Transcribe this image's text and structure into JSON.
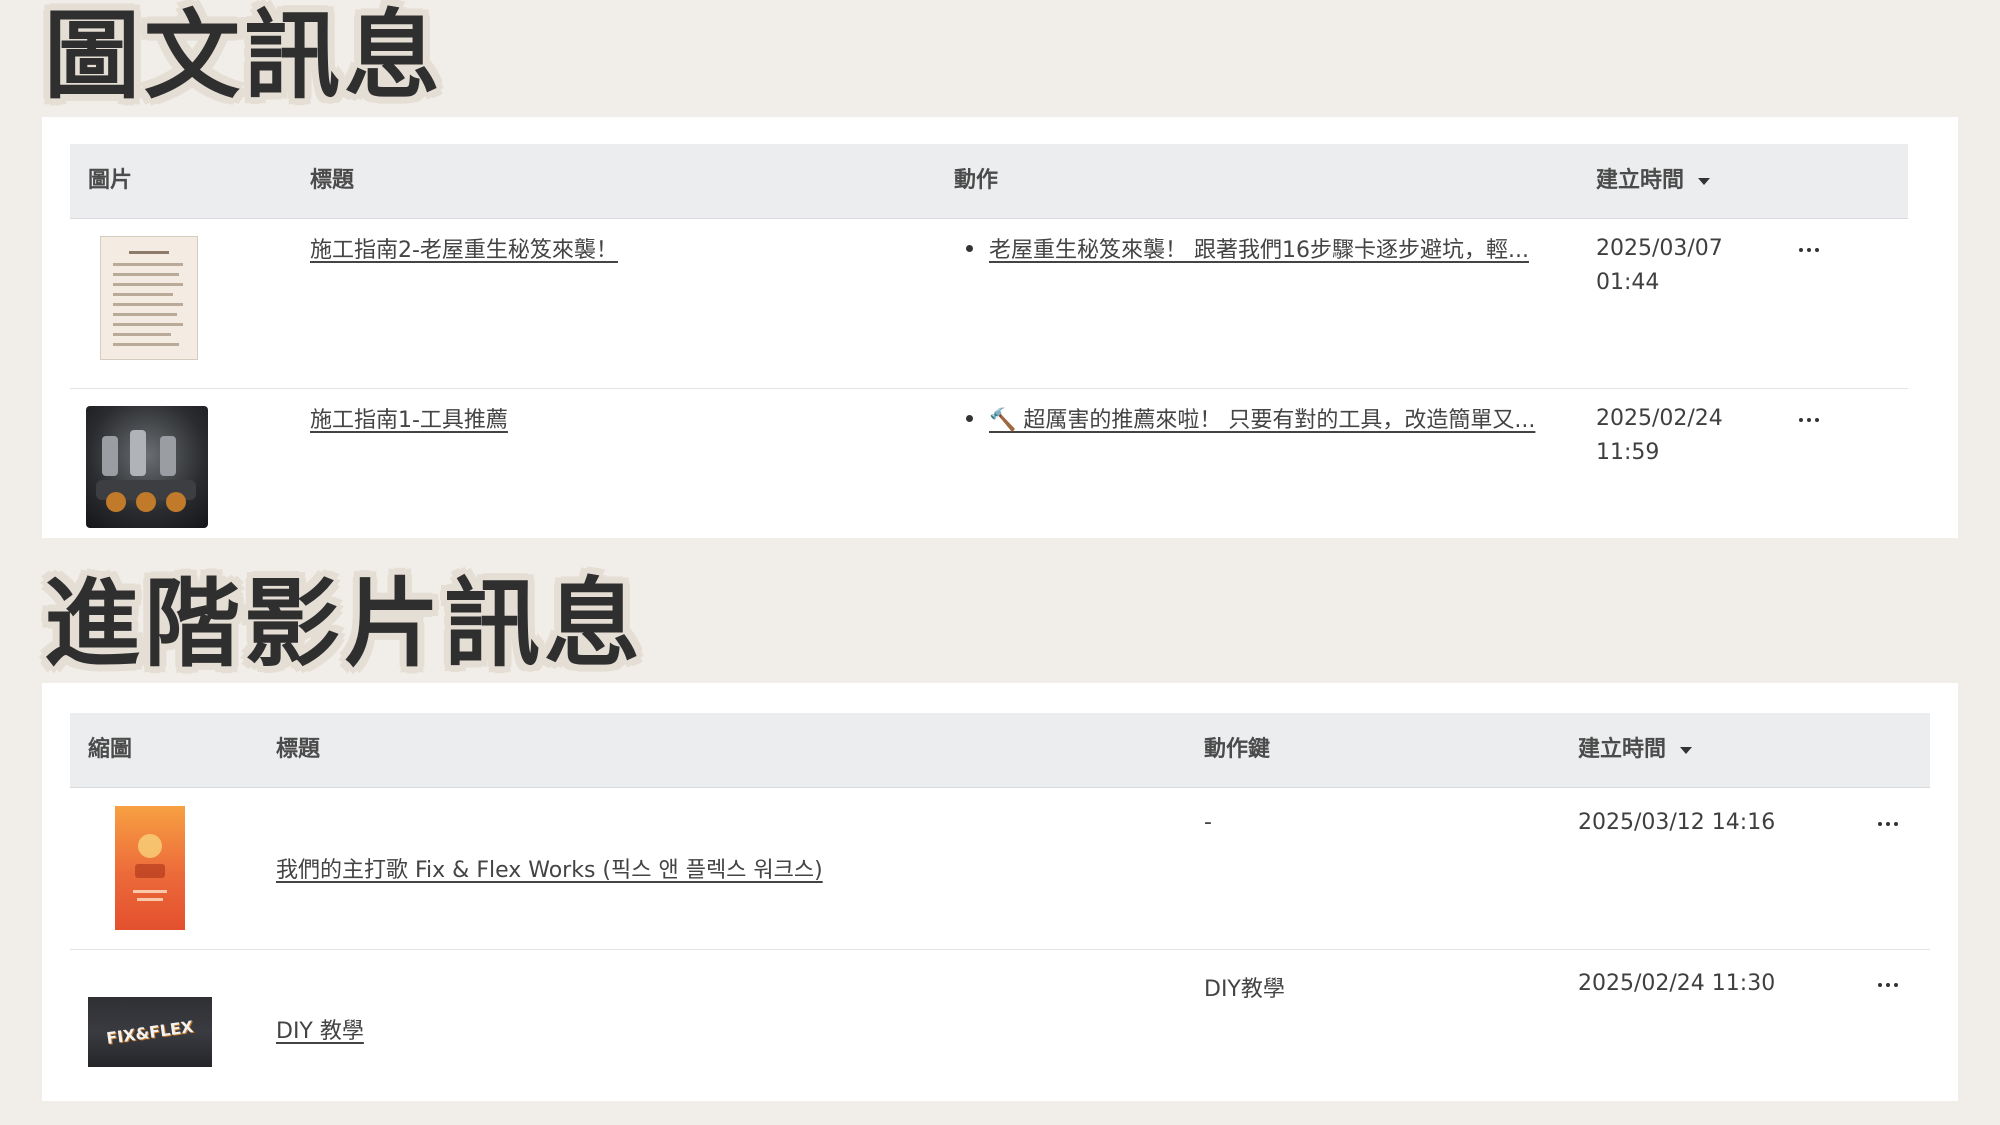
{
  "section1": {
    "title": "圖文訊息",
    "headers": {
      "image": "圖片",
      "title": "標題",
      "action": "動作",
      "created": "建立時間"
    },
    "rows": [
      {
        "title": "施工指南2-老屋重生秘笈來襲！",
        "action": "老屋重生秘笈來襲！ 跟著我們16步驟卡逐步避坑，輕...",
        "date": "2025/03/07",
        "time": "01:44",
        "thumb_icon": "document-thumbnail"
      },
      {
        "title": "施工指南1-工具推薦",
        "action": "🔨 超厲害的推薦來啦！ 只要有對的工具，改造簡單又...",
        "date": "2025/02/24",
        "time": "11:59",
        "thumb_icon": "power-tools-thumbnail"
      }
    ]
  },
  "section2": {
    "title": "進階影片訊息",
    "headers": {
      "thumbnail": "縮圖",
      "title": "標題",
      "action_key": "動作鍵",
      "created": "建立時間"
    },
    "rows": [
      {
        "title": "我們的主打歌 Fix & Flex Works (픽스 앤 플렉스 워크스)",
        "action_key": "-",
        "datetime": "2025/03/12 14:16",
        "thumb_icon": "orange-poster-thumbnail"
      },
      {
        "title": "DIY 教學",
        "action_key": "DIY教學",
        "datetime": "2025/02/24 11:30",
        "thumb_icon": "fix-and-flex-logo-thumbnail",
        "thumb_text": "FIX&FLEX"
      }
    ]
  },
  "colors": {
    "page_bg": "#f1eee9",
    "panel_bg": "#ffffff",
    "header_bg": "#ebedef"
  }
}
